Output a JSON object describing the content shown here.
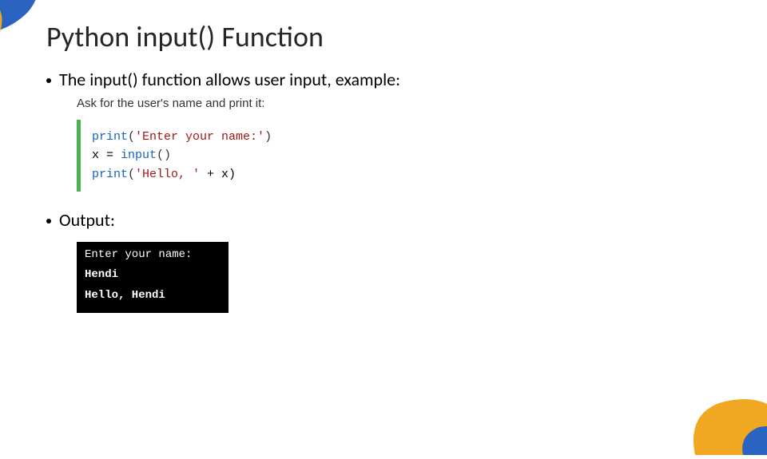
{
  "title": "Python input() Function",
  "bullets": {
    "intro": "The input() function allows user input, example:",
    "output_label": "Output:"
  },
  "code": {
    "desc": "Ask for the user's name and print it:",
    "l1": {
      "fn": "print",
      "open": "(",
      "str": "'Enter your name:'",
      "close": ")"
    },
    "l2": {
      "lhs": "x = ",
      "fn": "input",
      "parens": "()"
    },
    "l3": {
      "fn": "print",
      "open": "(",
      "str": "'Hello, '",
      "plus": " + x)",
      "close": ""
    }
  },
  "terminal": {
    "l1": "Enter your name:",
    "l2": "Hendi",
    "l3": "Hello, Hendi"
  }
}
